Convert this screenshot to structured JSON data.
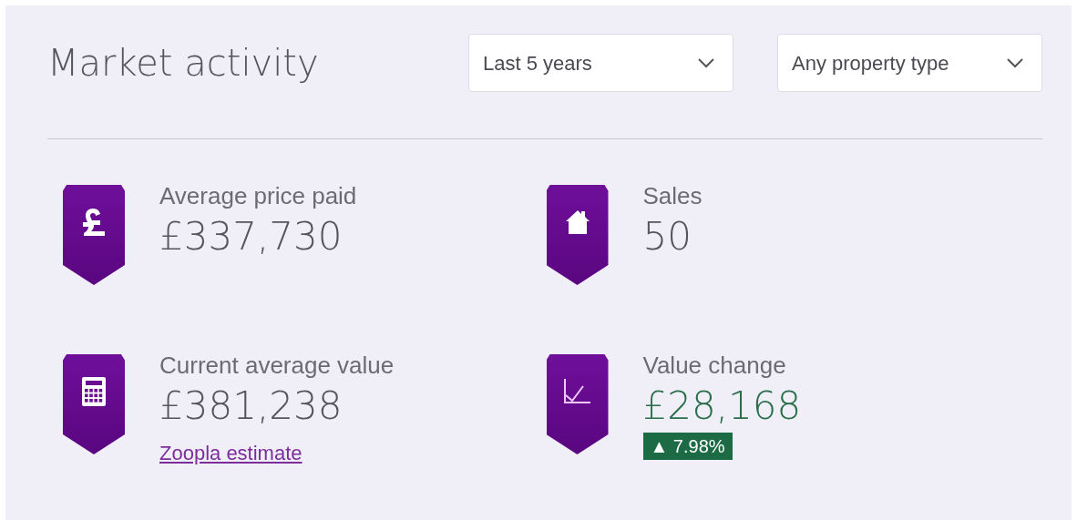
{
  "title": "Market activity",
  "filters": [
    {
      "value": "Last 5 years"
    },
    {
      "value": "Any property type"
    }
  ],
  "stats": [
    {
      "kind": "pound",
      "label": "Average price paid",
      "value": "£337,730"
    },
    {
      "kind": "house",
      "label": "Sales",
      "value": "50"
    },
    {
      "kind": "calculator",
      "label": "Current average value",
      "value": "£381,238",
      "link": "Zoopla estimate"
    },
    {
      "kind": "chart",
      "label": "Value change",
      "value": "£28,168",
      "change": {
        "positive": true,
        "text": "▲ 7.98%"
      }
    }
  ]
}
